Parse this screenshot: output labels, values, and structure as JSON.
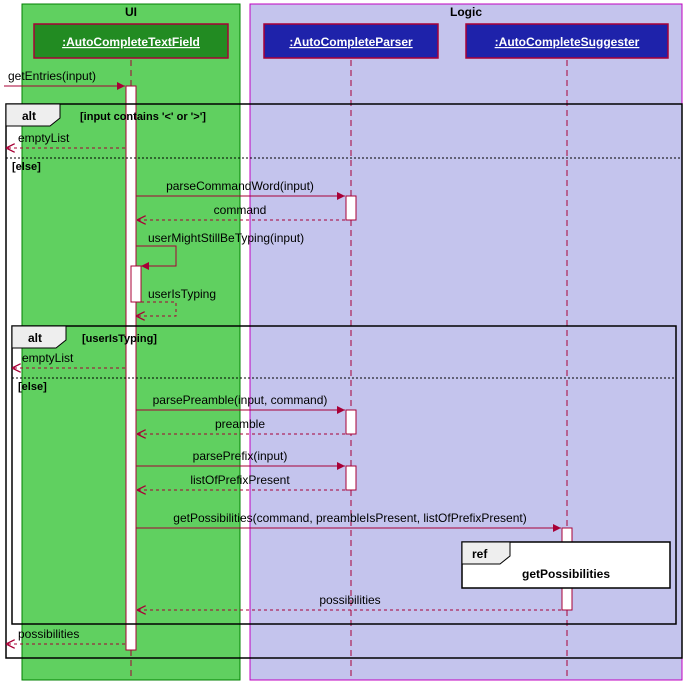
{
  "packages": {
    "ui": {
      "title": "UI"
    },
    "logic": {
      "title": "Logic"
    }
  },
  "participants": {
    "field": {
      "label": ":AutoCompleteTextField"
    },
    "parser": {
      "label": ":AutoCompleteParser"
    },
    "suggester": {
      "label": ":AutoCompleteSuggester"
    }
  },
  "messages": {
    "getEntries": "getEntries(input)",
    "emptyList1": "emptyList",
    "parseCommandWord": "parseCommandWord(input)",
    "command": "command",
    "userMightTyping": "userMightStillBeTyping(input)",
    "userIsTyping": "userIsTyping",
    "emptyList2": "emptyList",
    "parsePreamble": "parsePreamble(input, command)",
    "preamble": "preamble",
    "parsePrefix": "parsePrefix(input)",
    "listOfPrefix": "listOfPrefixPresent",
    "getPossibilities": "getPossibilities(command, preambleIsPresent, listOfPrefixPresent)",
    "possibilitiesBack": "possibilities",
    "possibilitiesOut": "possibilities"
  },
  "fragments": {
    "alt1": {
      "label": "alt",
      "guard": "[input contains '<' or '>']",
      "else": "[else]"
    },
    "alt2": {
      "label": "alt",
      "guard": "[userIsTyping]",
      "else": "[else]"
    },
    "ref": {
      "label": "ref",
      "title": "getPossibilities"
    }
  },
  "chart_data": {
    "type": "uml-sequence",
    "packages": [
      {
        "name": "UI",
        "participants": [
          "AutoCompleteTextField"
        ]
      },
      {
        "name": "Logic",
        "participants": [
          "AutoCompleteParser",
          "AutoCompleteSuggester"
        ]
      }
    ],
    "lifelines": [
      "caller",
      ":AutoCompleteTextField",
      ":AutoCompleteParser",
      ":AutoCompleteSuggester"
    ],
    "interactions": [
      {
        "from": "caller",
        "to": ":AutoCompleteTextField",
        "label": "getEntries(input)",
        "type": "call"
      },
      {
        "fragment": "alt",
        "guard": "input contains '<' or '>'",
        "children": [
          {
            "from": ":AutoCompleteTextField",
            "to": "caller",
            "label": "emptyList",
            "type": "return"
          }
        ],
        "else": [
          {
            "from": ":AutoCompleteTextField",
            "to": ":AutoCompleteParser",
            "label": "parseCommandWord(input)",
            "type": "call"
          },
          {
            "from": ":AutoCompleteParser",
            "to": ":AutoCompleteTextField",
            "label": "command",
            "type": "return"
          },
          {
            "from": ":AutoCompleteTextField",
            "to": ":AutoCompleteTextField",
            "label": "userMightStillBeTyping(input)",
            "type": "self-call"
          },
          {
            "from": ":AutoCompleteTextField",
            "to": ":AutoCompleteTextField",
            "label": "userIsTyping",
            "type": "self-return"
          },
          {
            "fragment": "alt",
            "guard": "userIsTyping",
            "children": [
              {
                "from": ":AutoCompleteTextField",
                "to": "caller",
                "label": "emptyList",
                "type": "return"
              }
            ],
            "else": [
              {
                "from": ":AutoCompleteTextField",
                "to": ":AutoCompleteParser",
                "label": "parsePreamble(input, command)",
                "type": "call"
              },
              {
                "from": ":AutoCompleteParser",
                "to": ":AutoCompleteTextField",
                "label": "preamble",
                "type": "return"
              },
              {
                "from": ":AutoCompleteTextField",
                "to": ":AutoCompleteParser",
                "label": "parsePrefix(input)",
                "type": "call"
              },
              {
                "from": ":AutoCompleteParser",
                "to": ":AutoCompleteTextField",
                "label": "listOfPrefixPresent",
                "type": "return"
              },
              {
                "from": ":AutoCompleteTextField",
                "to": ":AutoCompleteSuggester",
                "label": "getPossibilities(command, preambleIsPresent, listOfPrefixPresent)",
                "type": "call"
              },
              {
                "ref": "getPossibilities",
                "on": ":AutoCompleteSuggester"
              },
              {
                "from": ":AutoCompleteSuggester",
                "to": ":AutoCompleteTextField",
                "label": "possibilities",
                "type": "return"
              }
            ]
          }
        ]
      },
      {
        "from": ":AutoCompleteTextField",
        "to": "caller",
        "label": "possibilities",
        "type": "return"
      }
    ]
  }
}
